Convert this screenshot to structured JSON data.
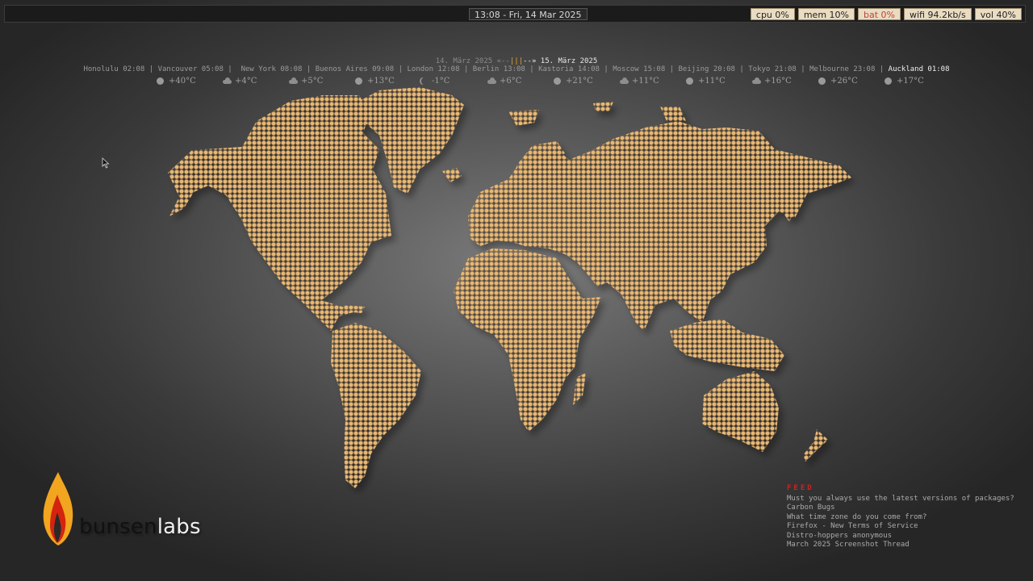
{
  "panel": {
    "clock": "13:08 - Fri, 14 Mar 2025",
    "status": [
      {
        "label": "cpu 0%"
      },
      {
        "label": "mem 10%"
      },
      {
        "label": "bat 0%"
      },
      {
        "label": "wifi 94.2kb/s"
      },
      {
        "label": "vol 40%"
      }
    ]
  },
  "dates": {
    "left": "14. März 2025 «--",
    "marker": "|||",
    "right": "--» 15. März 2025"
  },
  "zones": [
    "Honolulu 02:08",
    "Vancouver 05:08",
    "New York 08:08",
    "Buenos Aires 09:08",
    "London 12:08",
    "Berlin 13:08",
    "Kastoria 14:08",
    "Moscow 15:08",
    "Beijing 20:08",
    "Tokyo 21:08",
    "Melbourne 23:08",
    "Auckland 01:08"
  ],
  "temps": [
    {
      "icon": "sun-icon",
      "value": "+40°C"
    },
    {
      "icon": "cloud-icon",
      "value": "+4°C"
    },
    {
      "icon": "cloud-icon",
      "value": "+5°C"
    },
    {
      "icon": "sun-icon",
      "value": "+13°C"
    },
    {
      "icon": "moon-icon",
      "value": "-1°C"
    },
    {
      "icon": "cloud-icon",
      "value": "+6°C"
    },
    {
      "icon": "sun-icon",
      "value": "+21°C"
    },
    {
      "icon": "cloud-icon",
      "value": "+11°C"
    },
    {
      "icon": "sun-icon",
      "value": "+11°C"
    },
    {
      "icon": "cloud-icon",
      "value": "+16°C"
    },
    {
      "icon": "sun-icon",
      "value": "+26°C"
    },
    {
      "icon": "sun-icon",
      "value": "+17°C"
    }
  ],
  "logo": {
    "part1": "bunsen",
    "part2": "labs"
  },
  "feed": {
    "title": "FEED",
    "items": [
      "Must you always use the latest versions of packages?",
      "Carbon Bugs",
      "What time zone do you come from?",
      "Firefox - New Terms of Service",
      "Distro-hoppers anonymous",
      "March 2025 Screenshot Thread"
    ]
  },
  "colors": {
    "dot": "#e2b679",
    "dot_edge": "#a07840",
    "flame_outer": "#f0a020",
    "flame_inner": "#d02010",
    "feed_title": "#d81e1e"
  }
}
